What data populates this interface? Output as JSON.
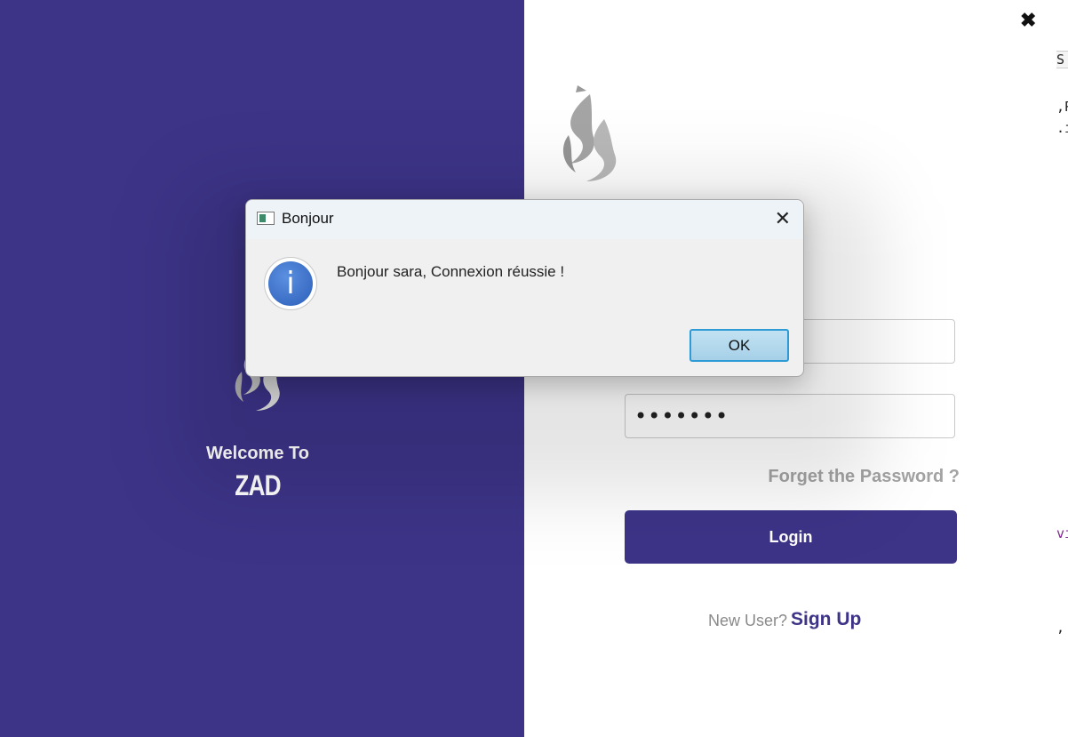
{
  "brand": {
    "welcome": "Welcome To",
    "name": "ZAD"
  },
  "login": {
    "password_masked": "•••••••",
    "forgot_password": "Forget the Password ?",
    "login_button": "Login",
    "new_user": "New User?",
    "sign_up": "Sign Up",
    "close_symbol": "✖"
  },
  "dialog": {
    "title": "Bonjour",
    "message": "Bonjour sara, Connexion réussie !",
    "ok_button": "OK",
    "close_symbol": "✕",
    "info_symbol": "i"
  },
  "edge_fragments": [
    "S",
    ",P",
    ".i",
    "vi",
    ","
  ],
  "colors": {
    "primary": "#3d3488",
    "muted": "#a3a3a3",
    "ok_border": "#2f9bd6"
  },
  "icons": [
    "logo-flame-icon",
    "info-icon",
    "window-app-icon",
    "close-icon"
  ]
}
